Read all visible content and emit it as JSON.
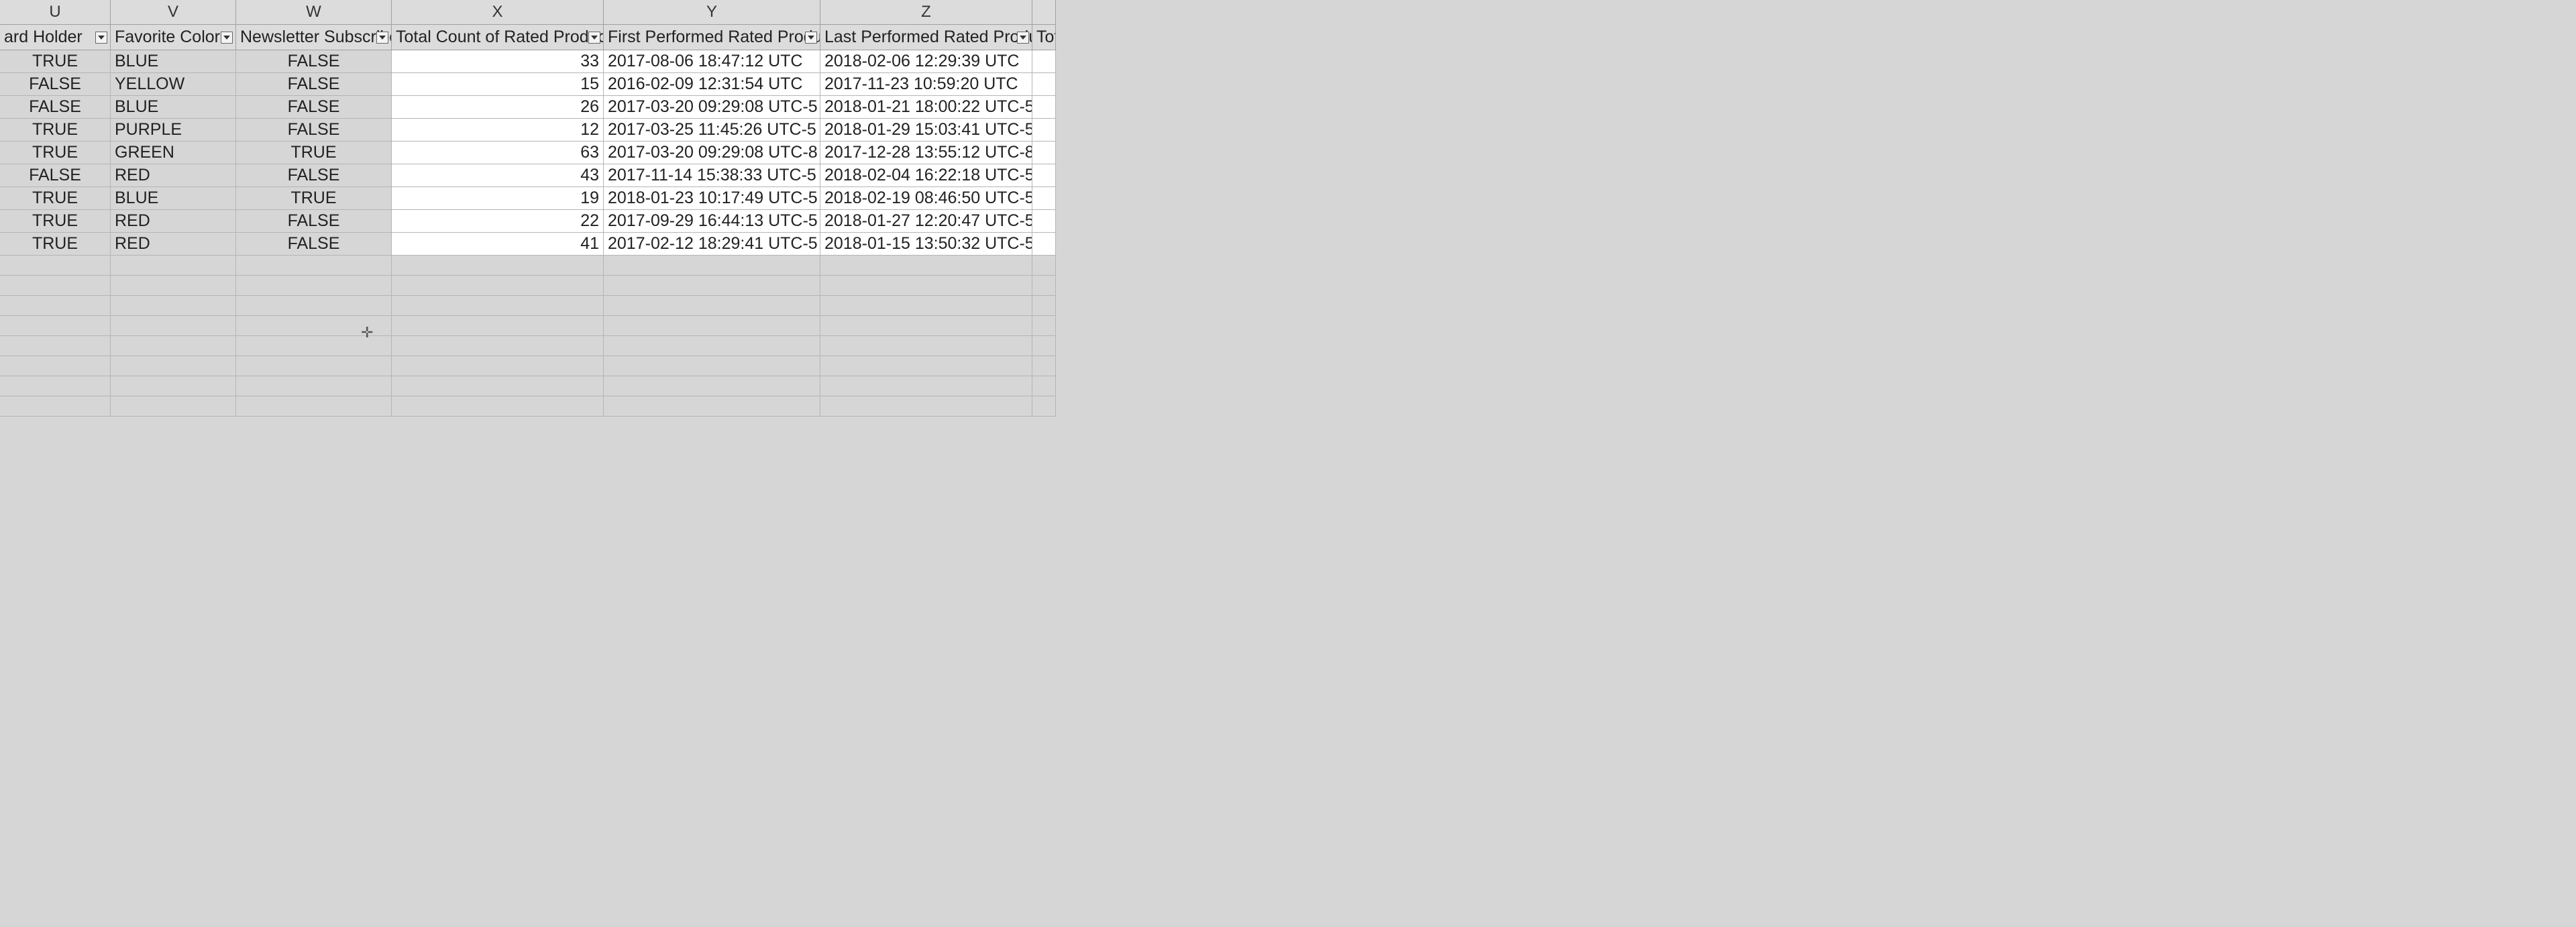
{
  "columns": [
    {
      "letter": "U",
      "header": "ard Holder",
      "align": "center",
      "white": false
    },
    {
      "letter": "V",
      "header": "Favorite Color",
      "align": "left",
      "white": false
    },
    {
      "letter": "W",
      "header": "Newsletter Subscriber",
      "align": "center",
      "white": false
    },
    {
      "letter": "X",
      "header": "Total Count of Rated Product",
      "align": "right",
      "white": true
    },
    {
      "letter": "Y",
      "header": "First Performed Rated Product",
      "align": "left",
      "white": true
    },
    {
      "letter": "Z",
      "header": "Last Performed Rated Product",
      "align": "left",
      "white": true
    }
  ],
  "overflow_header": "Tot",
  "rows": [
    {
      "u": "TRUE",
      "v": "BLUE",
      "w": "FALSE",
      "x": "33",
      "y": "2017-08-06 18:47:12 UTC",
      "z": "2018-02-06 12:29:39 UTC"
    },
    {
      "u": "FALSE",
      "v": "YELLOW",
      "w": "FALSE",
      "x": "15",
      "y": "2016-02-09 12:31:54 UTC",
      "z": "2017-11-23 10:59:20 UTC"
    },
    {
      "u": "FALSE",
      "v": "BLUE",
      "w": "FALSE",
      "x": "26",
      "y": "2017-03-20 09:29:08 UTC-5",
      "z": "2018-01-21 18:00:22 UTC-5"
    },
    {
      "u": "TRUE",
      "v": "PURPLE",
      "w": "FALSE",
      "x": "12",
      "y": "2017-03-25 11:45:26 UTC-5",
      "z": "2018-01-29 15:03:41 UTC-5"
    },
    {
      "u": "TRUE",
      "v": "GREEN",
      "w": "TRUE",
      "x": "63",
      "y": "2017-03-20 09:29:08 UTC-8",
      "z": "2017-12-28 13:55:12 UTC-8"
    },
    {
      "u": "FALSE",
      "v": "RED",
      "w": "FALSE",
      "x": "43",
      "y": "2017-11-14 15:38:33 UTC-5",
      "z": "2018-02-04 16:22:18 UTC-5"
    },
    {
      "u": "TRUE",
      "v": "BLUE",
      "w": "TRUE",
      "x": "19",
      "y": "2018-01-23 10:17:49 UTC-5",
      "z": "2018-02-19 08:46:50 UTC-5"
    },
    {
      "u": "TRUE",
      "v": "RED",
      "w": "FALSE",
      "x": "22",
      "y": "2017-09-29 16:44:13 UTC-5",
      "z": "2018-01-27 12:20:47 UTC-5"
    },
    {
      "u": "TRUE",
      "v": "RED",
      "w": "FALSE",
      "x": "41",
      "y": "2017-02-12 18:29:41 UTC-5",
      "z": "2018-01-15 13:50:32 UTC-5"
    }
  ],
  "empty_rows": 8,
  "cursor_glyph": "✛"
}
